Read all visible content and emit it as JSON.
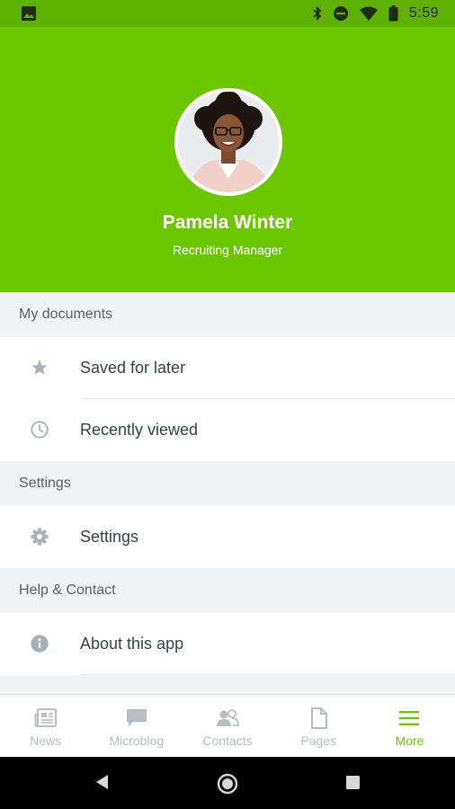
{
  "status_bar": {
    "time": "5:59",
    "icons": [
      "image-icon",
      "bluetooth-icon",
      "do-not-disturb-icon",
      "wifi-icon",
      "battery-icon"
    ]
  },
  "profile": {
    "name": "Pamela Winter",
    "role": "Recruiting Manager",
    "header_color": "#6cc700"
  },
  "sections": {
    "my_documents": {
      "title": "My documents",
      "items": [
        {
          "label": "Saved for later",
          "icon": "star-icon"
        },
        {
          "label": "Recently viewed",
          "icon": "clock-icon"
        }
      ]
    },
    "settings": {
      "title": "Settings",
      "items": [
        {
          "label": "Settings",
          "icon": "gear-icon"
        }
      ]
    },
    "help": {
      "title": "Help & Contact",
      "items": [
        {
          "label": "About this app",
          "icon": "info-icon"
        }
      ]
    }
  },
  "tabs": [
    {
      "label": "News",
      "icon": "newspaper-icon",
      "active": false
    },
    {
      "label": "Microblog",
      "icon": "chat-icon",
      "active": false
    },
    {
      "label": "Contacts",
      "icon": "contacts-icon",
      "active": false
    },
    {
      "label": "Pages",
      "icon": "page-icon",
      "active": false
    },
    {
      "label": "More",
      "icon": "menu-icon",
      "active": true
    }
  ],
  "colors": {
    "accent": "#6cc700",
    "tab_inactive": "#b9bec4",
    "icon_gray": "#aab1ba"
  }
}
